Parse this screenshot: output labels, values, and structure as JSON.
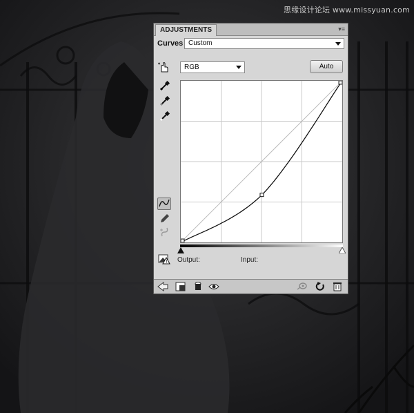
{
  "watermark": "思缘设计论坛 www.missyuan.com",
  "panel": {
    "tab_label": "ADJUSTMENTS",
    "menu_glyph": "▾≡",
    "adjustment_label": "Curves",
    "preset_value": "Custom",
    "channel_value": "RGB",
    "auto_label": "Auto",
    "output_label": "Output:",
    "input_label": "Input:"
  },
  "curve": {
    "points_input": [
      0,
      128,
      255
    ],
    "points_output": [
      0,
      75,
      255
    ]
  },
  "icons": {
    "targeted_adjust": "hand-target-icon",
    "black_point": "eyedropper-black-icon",
    "gray_point": "eyedropper-gray-icon",
    "white_point": "eyedropper-white-icon",
    "curve_tool": "curve-tool-icon",
    "pencil_tool": "pencil-icon",
    "smooth_tool": "smooth-curve-icon",
    "clipping_warning": "clipping-warning-icon",
    "back": "back-arrow-icon",
    "expand": "expand-view-icon",
    "clip_layer": "clip-layer-icon",
    "visibility": "eye-icon",
    "previous_state": "previous-state-icon",
    "reset": "reset-icon",
    "delete": "trash-icon"
  },
  "colors": {
    "panel_bg": "#d6d6d6",
    "background": "#1e1e20"
  }
}
